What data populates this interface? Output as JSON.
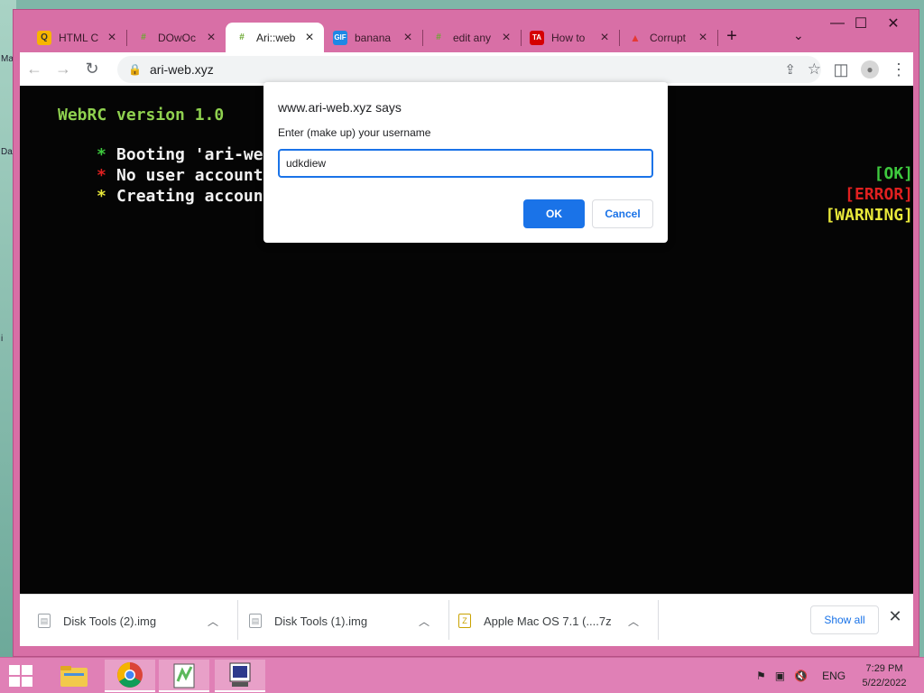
{
  "desktop": {
    "edge_labels": [
      "Ma",
      "Da",
      "i"
    ]
  },
  "tabs": [
    {
      "title": "HTML C",
      "favicon": "qr-icon",
      "favicon_text": "Q",
      "favicon_bg": "#f7b500",
      "active": false
    },
    {
      "title": "DOwOc",
      "favicon": "replit-icon",
      "favicon_text": "#",
      "favicon_bg": "#7fbf3f",
      "active": false
    },
    {
      "title": "Ari::web",
      "favicon": "replit-icon",
      "favicon_text": "#",
      "favicon_bg": "#7fbf3f",
      "active": true
    },
    {
      "title": "banana",
      "favicon": "gif-icon",
      "favicon_text": "GIF",
      "favicon_bg": "#1e88e5",
      "active": false
    },
    {
      "title": "edit any",
      "favicon": "replit-icon",
      "favicon_text": "#",
      "favicon_bg": "#7fbf3f",
      "active": false
    },
    {
      "title": "How to",
      "favicon": "tinkercad-icon",
      "favicon_text": "TA",
      "favicon_bg": "#d50000",
      "active": false
    },
    {
      "title": "Corrupt",
      "favicon": "tree-icon",
      "favicon_text": "▲",
      "favicon_bg": "#ffffff",
      "active": false
    }
  ],
  "toolbar": {
    "url": "ari-web.xyz"
  },
  "terminal": {
    "header": "WebRC version 1.0",
    "lines": [
      {
        "bullet": "*",
        "bullet_color": "#3ec93e",
        "text": "Booting 'ari-web'...",
        "status": "[OK]",
        "status_color": "#3ec93e"
      },
      {
        "bullet": "*",
        "bullet_color": "#e02020",
        "text": "No user account found",
        "status": "[ERROR]",
        "status_color": "#e02020"
      },
      {
        "bullet": "*",
        "bullet_color": "#e8e83a",
        "text": "Creating account",
        "status": "[WARNING]",
        "status_color": "#e8e83a"
      }
    ],
    "header_color": "#8fd14f"
  },
  "dialog": {
    "origin": "www.ari-web.xyz says",
    "message": "Enter (make up) your username",
    "input_value": "udkdiew",
    "ok_label": "OK",
    "cancel_label": "Cancel"
  },
  "downloads": {
    "items": [
      {
        "name": "Disk Tools (2).img",
        "icon": "file-icon"
      },
      {
        "name": "Disk Tools (1).img",
        "icon": "file-icon"
      },
      {
        "name": "Apple Mac OS 7.1 (....7z",
        "icon": "archive-icon"
      }
    ],
    "show_all_label": "Show all"
  },
  "taskbar": {
    "apps": [
      "file-explorer-icon",
      "chrome-icon",
      "notepad-plus-icon",
      "virtual-machine-icon"
    ],
    "language": "ENG",
    "time": "7:29 PM",
    "date": "5/22/2022"
  }
}
